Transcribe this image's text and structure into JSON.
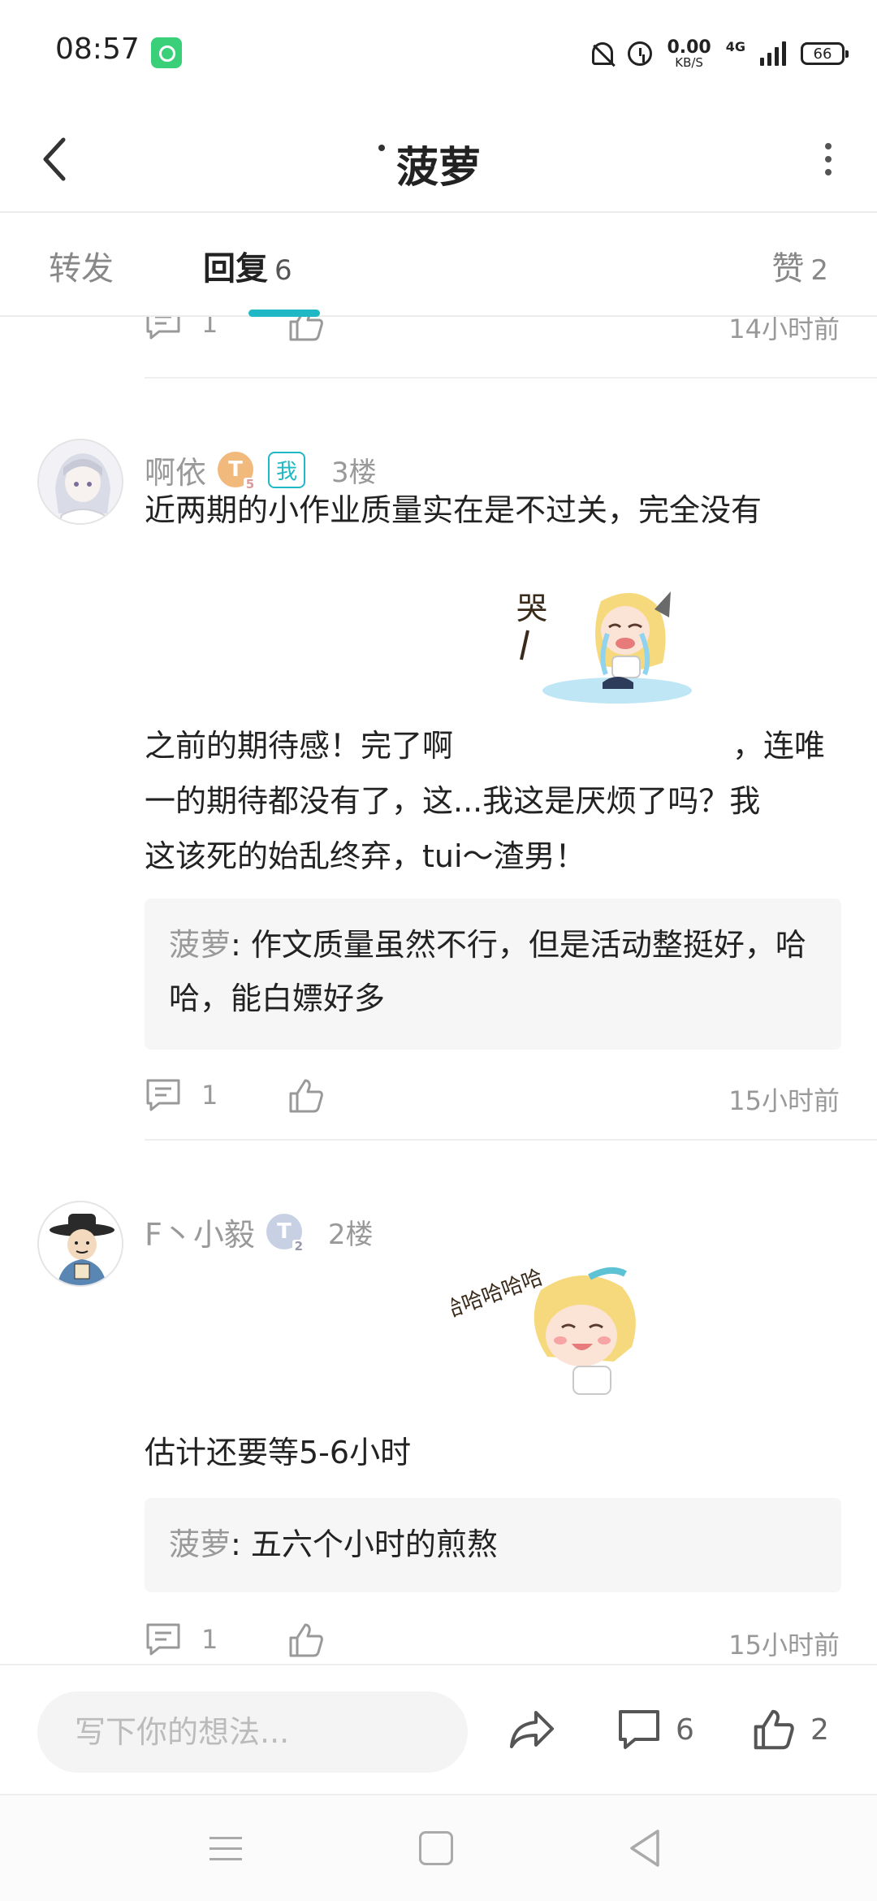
{
  "status_bar": {
    "time": "08:57",
    "speed_value": "0.00",
    "speed_unit": "KB/S",
    "network": "4G",
    "battery": "66"
  },
  "header": {
    "title": "菠萝"
  },
  "tabs": [
    {
      "label": "转发",
      "count": ""
    },
    {
      "label": "回复",
      "count": "6"
    },
    {
      "label": "赞",
      "count": "2"
    }
  ],
  "prev_comment": {
    "reply_count": "1",
    "time": "14小时前"
  },
  "comments": [
    {
      "user": "啊依",
      "level": "T",
      "level_sub": "5",
      "me_badge": "我",
      "floor": "3楼",
      "text_part1": "近两期的小作业质量实在是不过关，完全没有",
      "text_part2": "之前的期待感！完了啊",
      "text_part3": "，连唯",
      "text_part4": "一的期待都没有了，这...我这是厌烦了吗？我",
      "text_part5": "这该死的始乱终弃，tui～渣男！",
      "sticker_caption": "哭",
      "reply_name": "菠萝",
      "reply_sep": ":",
      "reply_text": " 作文质量虽然不行，但是活动整挺好，哈哈，能白嫖好多",
      "reply_count": "1",
      "time": "15小时前"
    },
    {
      "user": "F丶小毅",
      "level": "T",
      "level_sub": "2",
      "floor": "2楼",
      "text": "估计还要等5-6小时",
      "sticker_caption": "哈哈哈哈哈",
      "reply_name": "菠萝",
      "reply_sep": ":",
      "reply_text": " 五六个小时的煎熬",
      "reply_count": "1",
      "time": "15小时前"
    }
  ],
  "bottom_bar": {
    "input_placeholder": "写下你的想法...",
    "comment_count": "6",
    "like_count": "2"
  },
  "colors": {
    "accent": "#21b8c6",
    "muted": "#999999"
  }
}
